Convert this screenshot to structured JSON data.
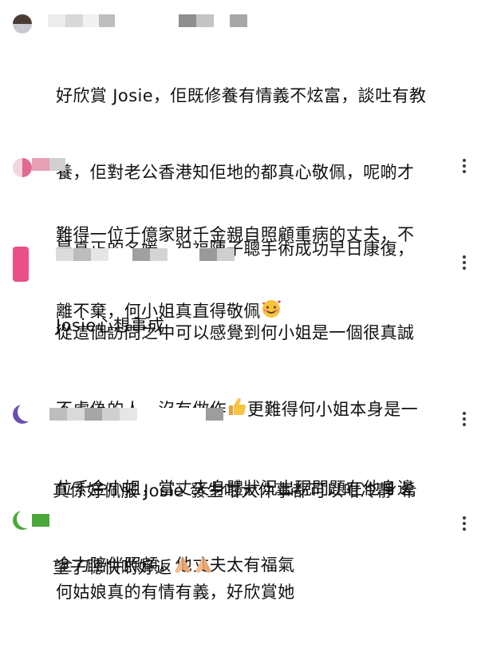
{
  "comments": [
    {
      "text": "好欣賞 Josie，佢既修養有情義不炫富，談吐有教養，佢對老公香港知佢地的都真心敬佩，呢啲才是真正的名媛，祝福陳子聰手術成功早日康復，Josie心想事成",
      "lines": [
        "好欣賞 Josie，佢既修養有情義不炫富，談吐有教",
        "養，佢對老公香港知佢地的都真心敬佩，呢啲才",
        "是真正的名媛，祝福陳子聰手術成功早日康復，",
        "Josie心想事成"
      ],
      "avatar_color": "#4a3b35"
    },
    {
      "lines_parts": [
        [
          "難得一位千億家財千金親自照顧重病的丈夫，不"
        ],
        [
          "離不棄，何小姐真直得敬佩",
          "smiling-face-with-hearts-emoji"
        ]
      ],
      "avatar_color": "#e7a6b8"
    },
    {
      "lines_parts": [
        [
          "從這個訪問之中可以感覺到何小姐是一個很真誠"
        ],
        [
          "不虛偽的人，沒有做作",
          "thumbs-up-emoji",
          "更難得何小姐本身是一"
        ],
        [
          "位千金小姐，當丈夫身體狀況出現問題在他身邊"
        ],
        [
          "全力陪伴照顧，他丈夫太有福氣"
        ]
      ],
      "avatar_color": "#ec4f88"
    },
    {
      "lines_parts": [
        [
          "真係好佩服 Josie 發生咁大件事都可以咁冷靜 希"
        ],
        [
          "望子聰快啲好返",
          "folded-hands-emoji",
          "folded-hands-emoji"
        ]
      ],
      "avatar_color": "#6a4fb3"
    },
    {
      "lines_parts": [
        [
          "何姑娘真的有情有義，好欣賞她"
        ]
      ],
      "avatar_color": "#4aa83b"
    }
  ],
  "icons": {
    "more": "more-vertical-icon"
  }
}
